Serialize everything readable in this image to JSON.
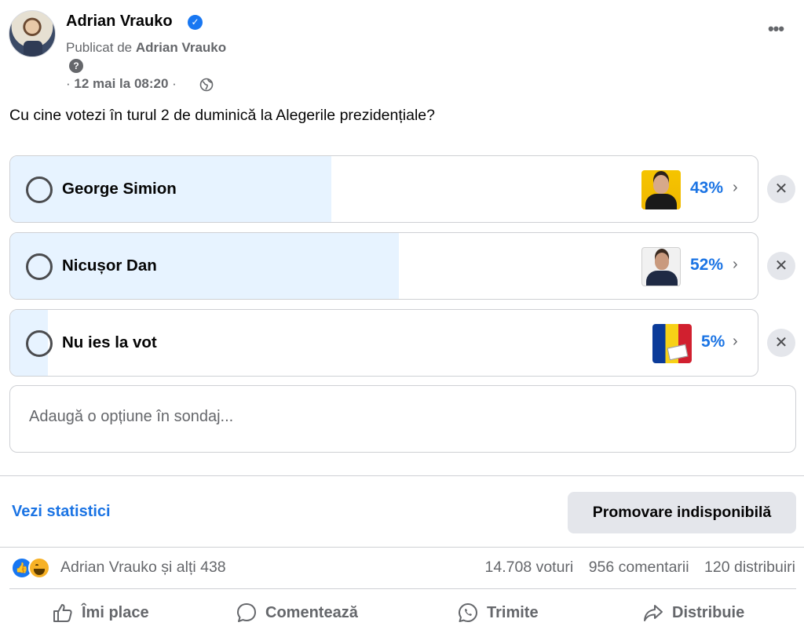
{
  "post": {
    "author": "Adrian Vrauko",
    "published_prefix": "Publicat de",
    "published_by": "Adrian Vrauko",
    "help_icon": "?",
    "date": "12 mai la 08:20",
    "more_icon": "•••",
    "question": "Cu cine votezi în turul 2 de duminică la Alegerile prezidențiale?"
  },
  "poll": {
    "options": [
      {
        "label": "George Simion",
        "percent_text": "43%",
        "percent": 43,
        "thumb_icon": "candidate-photo-simion"
      },
      {
        "label": "Nicușor Dan",
        "percent_text": "52%",
        "percent": 52,
        "thumb_icon": "candidate-photo-dan"
      },
      {
        "label": "Nu ies la vot",
        "percent_text": "5%",
        "percent": 5,
        "thumb_icon": "romanian-flag-ballot"
      }
    ],
    "add_placeholder": "Adaugă o opțiune în sondaj..."
  },
  "footer": {
    "stats_link": "Vezi statistici",
    "promote_button": "Promovare indisponibilă",
    "reactions_text": "Adrian Vrauko și alți 438",
    "votes": "14.708 voturi",
    "comments": "956 comentarii",
    "shares": "120 distribuiri"
  },
  "actions": {
    "like": "Îmi place",
    "comment": "Comentează",
    "send": "Trimite",
    "share": "Distribuie"
  },
  "colors": {
    "accent": "#1b74e4",
    "fill": "#e7f3ff",
    "secondary_text": "#65676b"
  }
}
